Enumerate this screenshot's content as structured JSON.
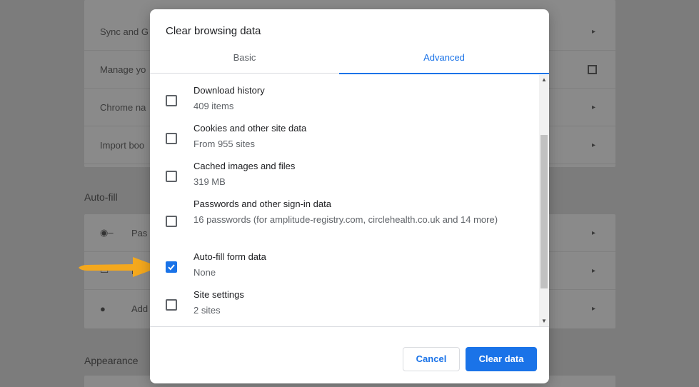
{
  "background": {
    "rows_top": [
      {
        "label": "Sync and G",
        "trailing": "chevron"
      },
      {
        "label": "Manage yo",
        "trailing": "external"
      },
      {
        "label": "Chrome na",
        "trailing": "chevron"
      },
      {
        "label": "Import boo",
        "trailing": "chevron"
      }
    ],
    "autofill_heading": "Auto-fill",
    "rows_autofill": [
      {
        "label": "Pas",
        "icon": "key-icon"
      },
      {
        "label": "P",
        "icon": "card-icon"
      },
      {
        "label": "Add",
        "icon": "location-pin-icon"
      }
    ],
    "appearance_heading": "Appearance"
  },
  "dialog": {
    "title": "Clear browsing data",
    "tabs": [
      {
        "label": "Basic",
        "selected": false
      },
      {
        "label": "Advanced",
        "selected": true
      }
    ],
    "items": [
      {
        "title": "Download history",
        "subtitle": "409 items",
        "checked": false
      },
      {
        "title": "Cookies and other site data",
        "subtitle": "From 955 sites",
        "checked": false
      },
      {
        "title": "Cached images and files",
        "subtitle": "319 MB",
        "checked": false
      },
      {
        "title": "Passwords and other sign-in data",
        "subtitle": "16 passwords (for amplitude-registry.com, circlehealth.co.uk and 14 more)",
        "checked": false
      },
      {
        "title": "Auto-fill form data",
        "subtitle": "None",
        "checked": true
      },
      {
        "title": "Site settings",
        "subtitle": "2 sites",
        "checked": false
      }
    ],
    "cancel_label": "Cancel",
    "clear_label": "Clear data"
  },
  "colors": {
    "accent": "#1a73e8",
    "arrow": "#f4a81d",
    "overlay": "#7c7c7c"
  }
}
